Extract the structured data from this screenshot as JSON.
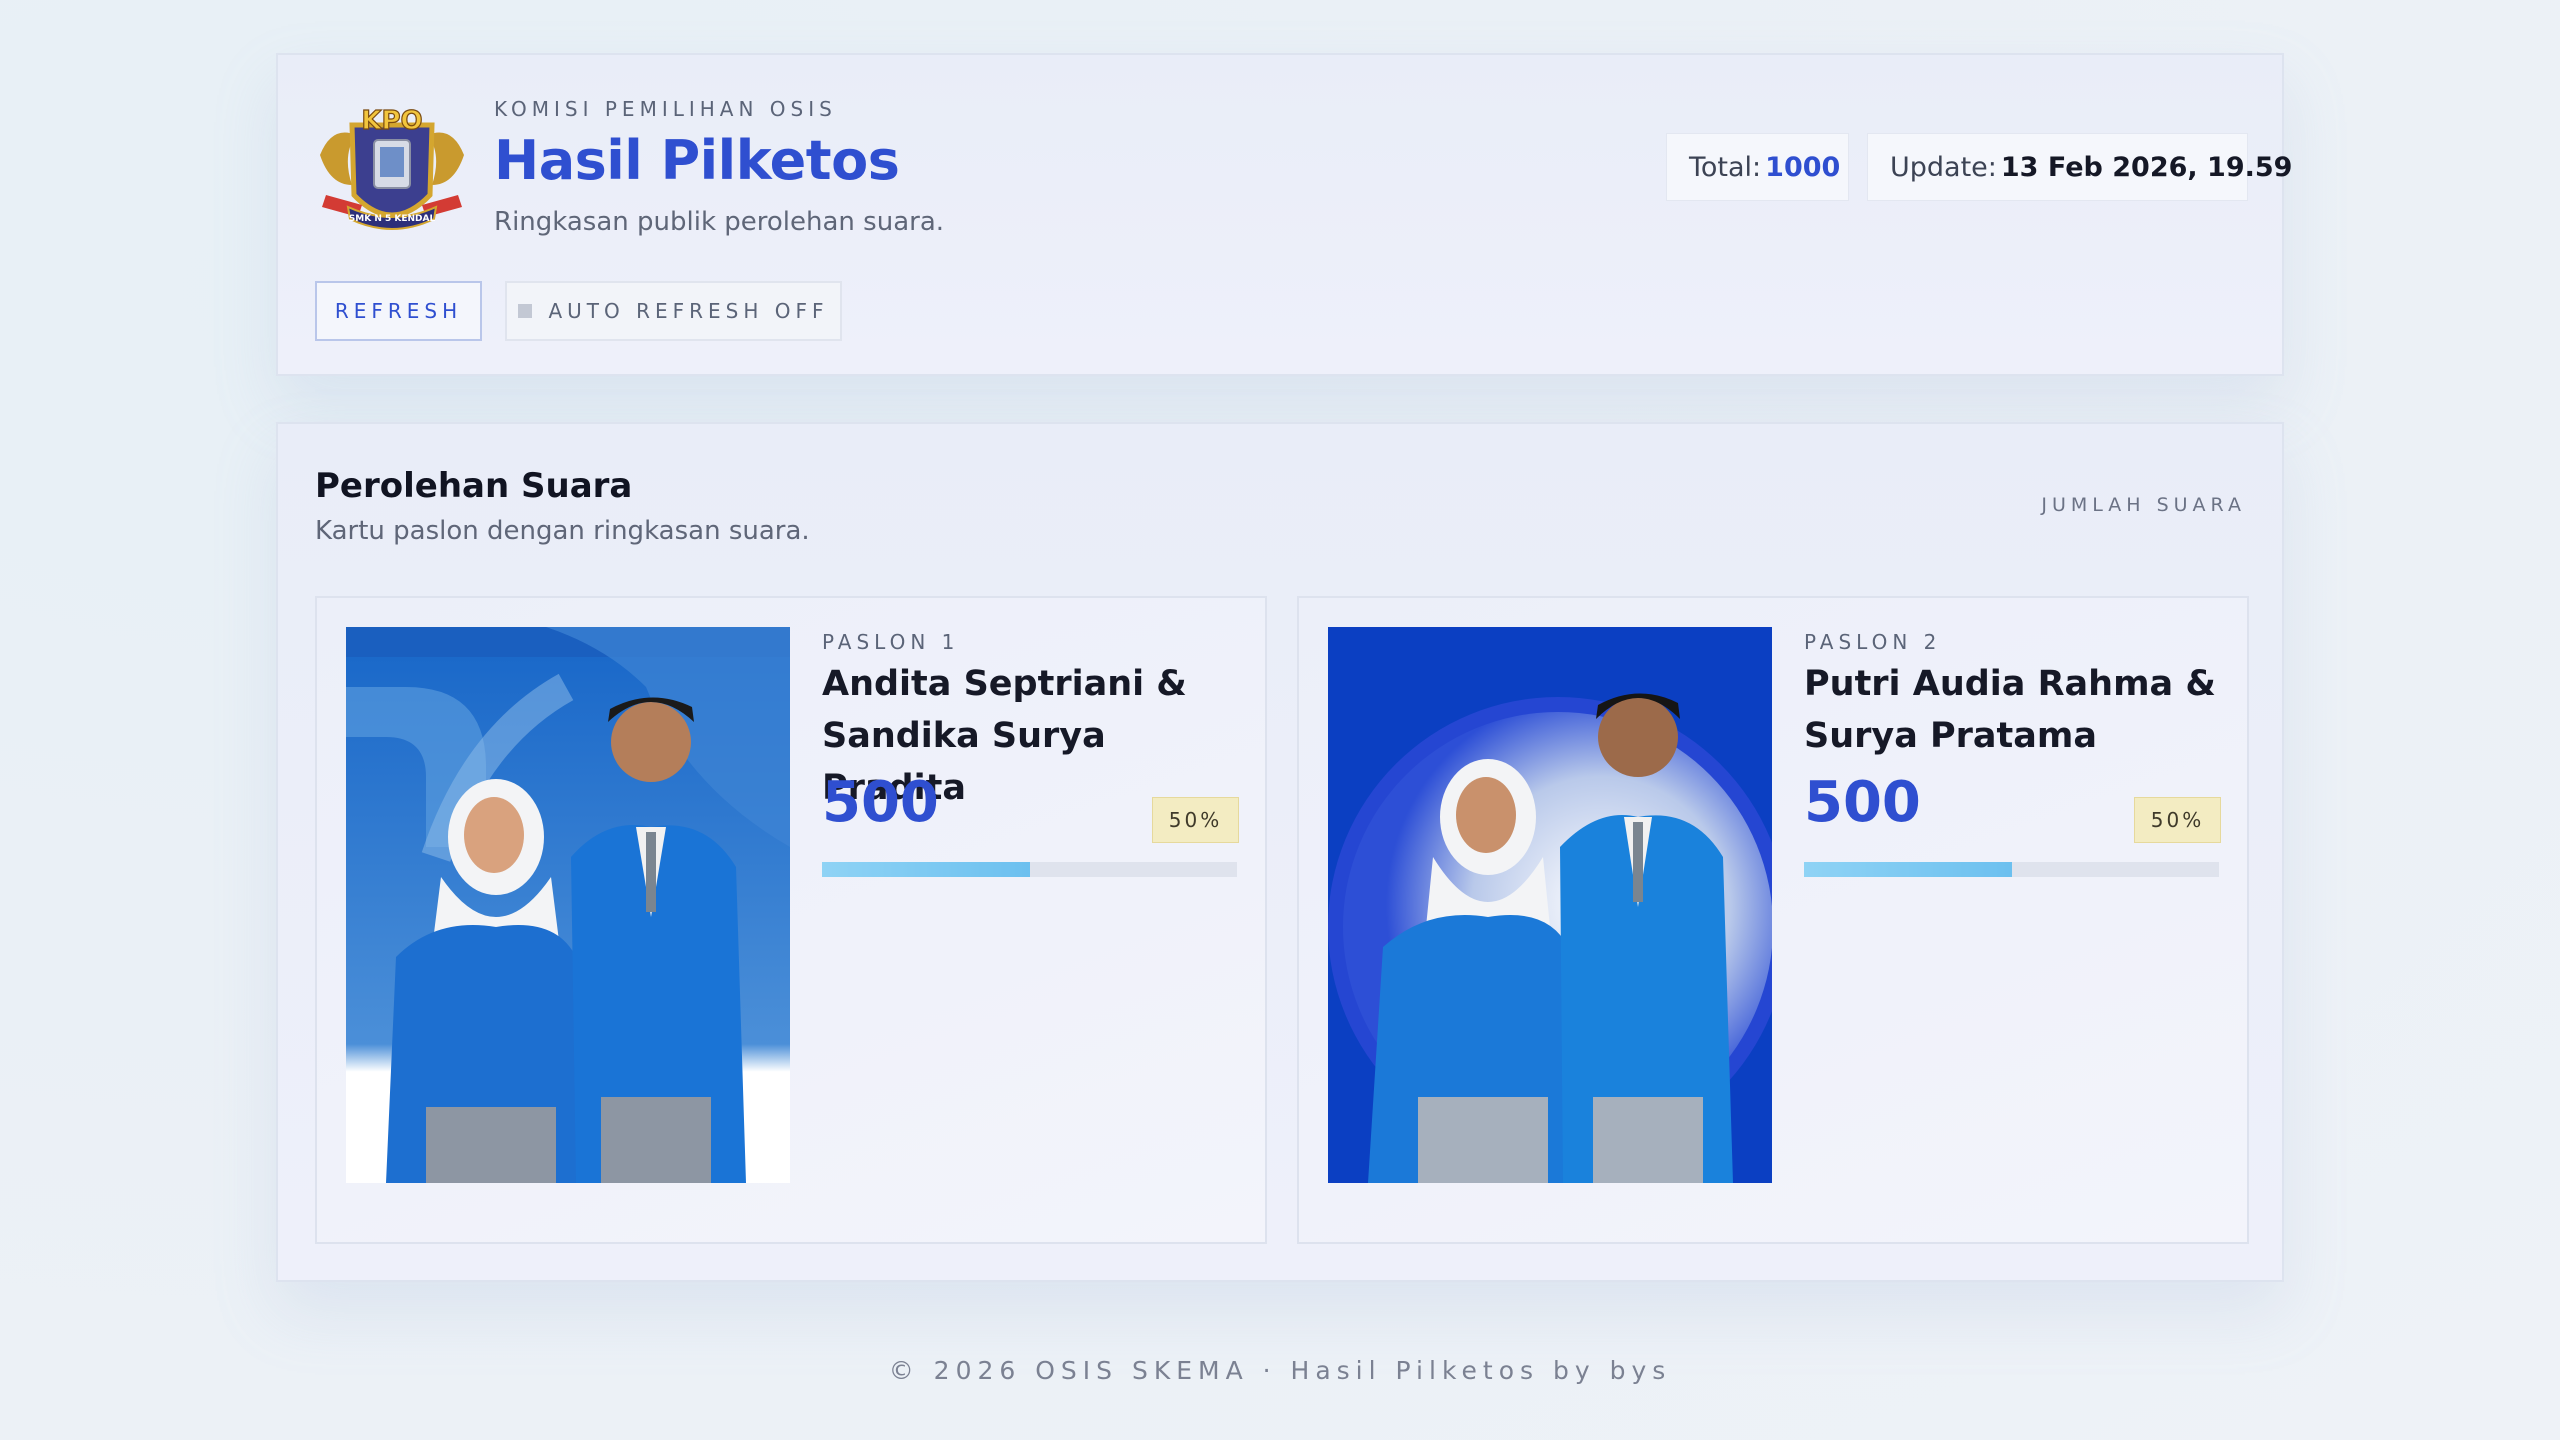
{
  "header": {
    "kicker": "KOMISI PEMILIHAN OSIS",
    "title": "Hasil Pilketos",
    "subtitle": "Ringkasan publik perolehan suara.",
    "total_label": "Total:",
    "total_value": "1000",
    "update_label": "Update:",
    "update_value": "13 Feb 2026, 19.59",
    "refresh_label": "REFRESH",
    "autorefresh_label": "AUTO REFRESH OFF",
    "logo_text": "KPO",
    "logo_caption": "SMK N 5 KENDAL"
  },
  "results": {
    "title": "Perolehan Suara",
    "subtitle": "Kartu paslon dengan ringkasan suara.",
    "right_label": "JUMLAH SUARA",
    "candidates": [
      {
        "label": "PASLON 1",
        "name": "Andita Septriani & Sandika Surya Pradita",
        "votes": "500",
        "percent_label": "50%",
        "share": 0.5
      },
      {
        "label": "PASLON 2",
        "name": "Putri Audia Rahma & Surya Pratama",
        "votes": "500",
        "percent_label": "50%",
        "share": 0.5
      }
    ]
  },
  "footer": {
    "text": "© 2026 OSIS SKEMA · Hasil Pilketos by bys"
  },
  "colors": {
    "accent": "#2f4fd0",
    "bar": "#6cc0ef",
    "badge": "#f3ecc2"
  }
}
